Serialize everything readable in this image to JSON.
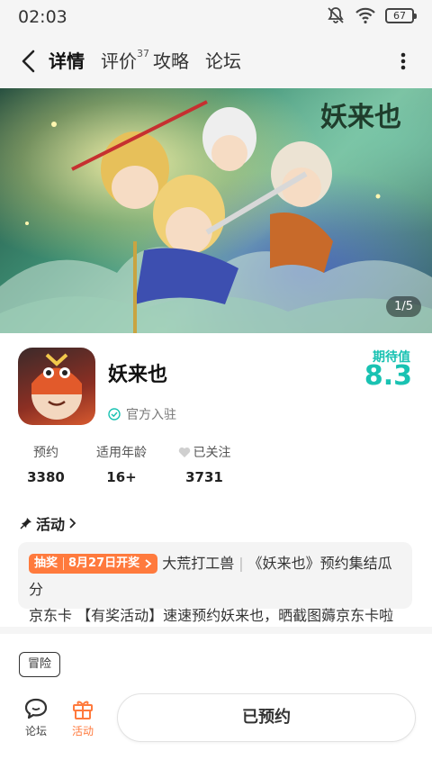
{
  "status_bar": {
    "time": "02:03",
    "battery": "67"
  },
  "nav": {
    "tabs": [
      {
        "label": "详情",
        "active": true
      },
      {
        "label": "评价",
        "count": "37"
      },
      {
        "label": "攻略"
      },
      {
        "label": "论坛"
      }
    ]
  },
  "banner": {
    "counter": "1/5",
    "title_art": "妖来也"
  },
  "game": {
    "name": "妖来也",
    "official_label": "官方入驻",
    "expect_label": "期待值",
    "expect_value": "8.3"
  },
  "stats": [
    {
      "label": "预约",
      "value": "3380"
    },
    {
      "label": "适用年龄",
      "value": "16+"
    },
    {
      "label": "已关注",
      "value": "3731"
    }
  ],
  "activity": {
    "heading": "活动",
    "badge_type": "抽奖",
    "badge_date": "8月27日开奖",
    "line1": "大荒打工兽",
    "line2": "《妖来也》预约集结瓜分",
    "line3": "京东卡 【有奖活动】速速预约妖来也，晒截图薅京东卡啦"
  },
  "tags": [
    "冒险"
  ],
  "bottom_bar": {
    "forum_label": "论坛",
    "activity_label": "活动",
    "reserve_label": "已预约"
  },
  "colors": {
    "accent": "#19c2b2",
    "orange": "#ff7a3d"
  }
}
